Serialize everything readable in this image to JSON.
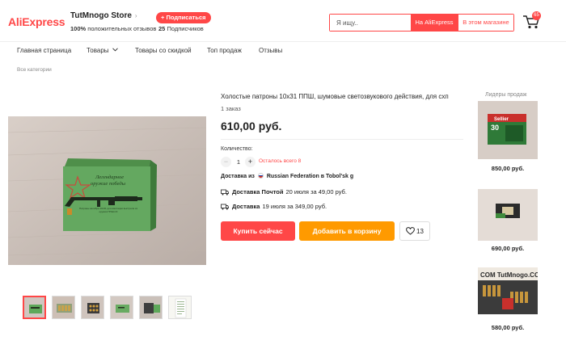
{
  "header": {
    "logo": "AliExpress",
    "store_name": "TutMnogo Store",
    "store_chevron": "›",
    "positive_pct": "100%",
    "positive_label": "положительных отзывов",
    "subscribe_label": "+ Подписаться",
    "subscribers_count": "25",
    "subscribers_label": "Подписчиков",
    "search_placeholder": "Я ищу..",
    "search_ali_label": "На AliExpress",
    "search_store_label": "В этом магазине",
    "cart_icon": "cart-icon",
    "cart_count": "65"
  },
  "nav": {
    "items": [
      "Главная страница",
      "Товары",
      "Товары со скидкой",
      "Топ продаж",
      "Отзывы"
    ],
    "chevron_icon": "chevron-down-icon"
  },
  "breadcrumb": "Все категории",
  "product": {
    "title": "Холостые патроны 10х31 ППШ, шумовые светозвукового действия, для схп",
    "orders": "1 заказ",
    "price": "610,00 руб.",
    "quantity_label": "Количество:",
    "quantity_value": "1",
    "minus_label": "−",
    "plus_label": "+",
    "stock_left": "Осталось всего 8",
    "delivery_prefix": "Доставка из",
    "delivery_from": "Russian Federation в Tobol'sk g",
    "shipping": [
      {
        "method": "Доставка Почтой",
        "detail": "20 июля за 49,00 руб."
      },
      {
        "method": "Доставка",
        "detail": "19 июля за 349,00 руб."
      }
    ],
    "buy_now_label": "Купить сейчас",
    "add_to_cart_label": "Добавить в корзину",
    "wishlist_count": "13",
    "box_text_line1": "Легендарное",
    "box_text_line2": "оружие победы",
    "box_small_text": "Патроны калибра 10х31 для имитации выстрела из оружия ППШ-СХ",
    "thumbnails_count": 6
  },
  "top_sellers": {
    "title": "Лидеры продаж",
    "items": [
      {
        "price": "850,00 руб.",
        "box_label": "Sellier"
      },
      {
        "price": "690,00 руб."
      },
      {
        "price": "580,00 руб.",
        "sign_text": "COM TutMnogo.COM"
      }
    ]
  },
  "colors": {
    "accent": "#ff4747",
    "orange": "#ff9a00"
  }
}
